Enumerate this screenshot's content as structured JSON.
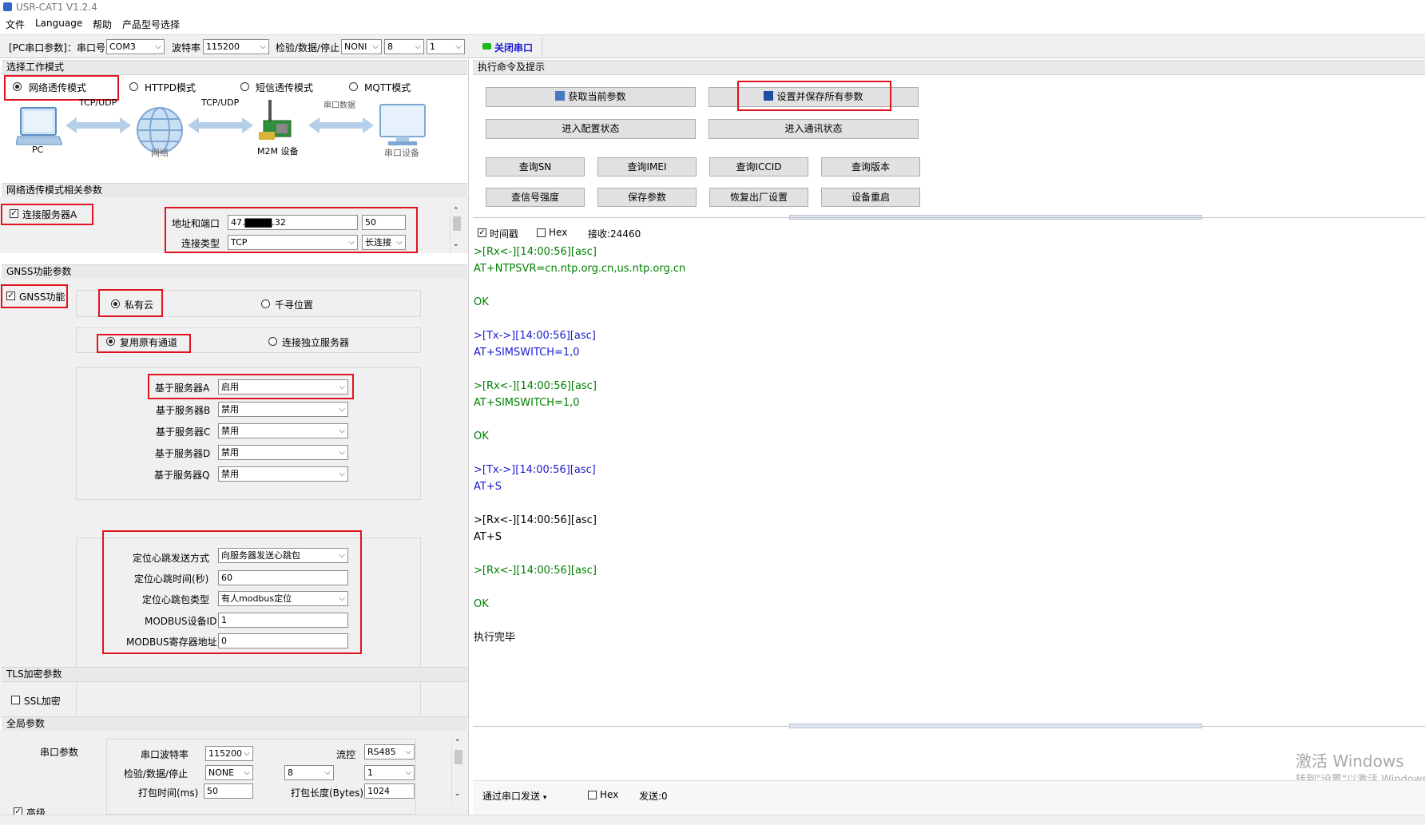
{
  "window": {
    "title": "USR-CAT1 V1.2.4"
  },
  "menu": [
    "文件",
    "Language",
    "帮助",
    "产品型号选择"
  ],
  "serial_bar": {
    "prefix": "[PC串口参数]：串口号",
    "port": "COM3",
    "baud_label": "波特率",
    "baud": "115200",
    "parity_label": "检验/数据/停止",
    "parity": "NONI",
    "data_bits": "8",
    "stop_bits": "1",
    "close_label": "关闭串口",
    "status_color": "#19b919"
  },
  "left": {
    "mode_header": "选择工作模式",
    "modes": [
      {
        "label": "网络透传模式",
        "selected": true
      },
      {
        "label": "HTTPD模式",
        "selected": false
      },
      {
        "label": "短信透传模式",
        "selected": false
      },
      {
        "label": "MQTT模式",
        "selected": false
      }
    ],
    "diagram": {
      "pc": "PC",
      "link1": "TCP/UDP",
      "net": "网络",
      "link2": "TCP/UDP",
      "m2m": "M2M 设备",
      "link3": "串口数据",
      "serial_dev": "串口设备"
    },
    "net_header": "网络透传模式相关参数",
    "server_a_label": "连接服务器A",
    "addr_label": "地址和端口",
    "addr_value": "47.▇▇▇▇.32",
    "port_value": "50",
    "conn_type_label": "连接类型",
    "conn_type": "TCP",
    "conn_mode": "长连接",
    "gnss_header": "GNSS功能参数",
    "gnss_label": "GNSS功能",
    "private_cloud": "私有云",
    "qianxun": "千寻位置",
    "reuse_channel": "复用原有通道",
    "independent_server": "连接独立服务器",
    "servers": [
      {
        "label": "基于服务器A",
        "value": "启用"
      },
      {
        "label": "基于服务器B",
        "value": "禁用"
      },
      {
        "label": "基于服务器C",
        "value": "禁用"
      },
      {
        "label": "基于服务器D",
        "value": "禁用"
      },
      {
        "label": "基于服务器Q",
        "value": "禁用"
      }
    ],
    "heartbeat": {
      "mode_label": "定位心跳发送方式",
      "mode_value": "向服务器发送心跳包",
      "interval_label": "定位心跳时间(秒)",
      "interval_value": "60",
      "type_label": "定位心跳包类型",
      "type_value": "有人modbus定位",
      "modbus_id_label": "MODBUS设备ID",
      "modbus_id_value": "1",
      "modbus_reg_label": "MODBUS寄存器地址",
      "modbus_reg_value": "0"
    },
    "tls_header": "TLS加密参数",
    "ssl_label": "SSL加密",
    "global_header": "全局参数",
    "serial_params_label": "串口参数",
    "g_baud_label": "串口波特率",
    "g_baud": "115200",
    "flow_label": "流控",
    "flow_value": "RS485",
    "g_parity_label": "检验/数据/停止",
    "g_parity": "NONE",
    "g_data": "8",
    "g_stop": "1",
    "pack_time_label": "打包时间(ms)",
    "pack_time": "50",
    "pack_len_label": "打包长度(Bytes)",
    "pack_len": "1024",
    "advanced_label": "高级"
  },
  "right": {
    "header": "执行命令及提示",
    "btn_get_params": "获取当前参数",
    "btn_set_save": "设置并保存所有参数",
    "btn_enter_config": "进入配置状态",
    "btn_enter_comm": "进入通讯状态",
    "btn_sn": "查询SN",
    "btn_imei": "查询IMEI",
    "btn_iccid": "查询ICCID",
    "btn_version": "查询版本",
    "btn_signal": "查信号强度",
    "btn_save": "保存参数",
    "btn_factory": "恢复出厂设置",
    "btn_reboot": "设备重启",
    "timestamp_label": "时间戳",
    "hex_label": "Hex",
    "recv_label": "接收:24460",
    "log": [
      {
        "text": ">[Rx<-][14:00:56][asc]",
        "color": "g"
      },
      {
        "text": "AT+NTPSVR=cn.ntp.org.cn,us.ntp.org.cn",
        "color": "g"
      },
      {
        "text": "",
        "color": "k"
      },
      {
        "text": "OK",
        "color": "g"
      },
      {
        "text": "",
        "color": "k"
      },
      {
        "text": ">[Tx->][14:00:56][asc]",
        "color": "b"
      },
      {
        "text": "AT+SIMSWITCH=1,0",
        "color": "b"
      },
      {
        "text": "",
        "color": "k"
      },
      {
        "text": ">[Rx<-][14:00:56][asc]",
        "color": "g"
      },
      {
        "text": "AT+SIMSWITCH=1,0",
        "color": "g"
      },
      {
        "text": "",
        "color": "k"
      },
      {
        "text": "OK",
        "color": "g"
      },
      {
        "text": "",
        "color": "k"
      },
      {
        "text": ">[Tx->][14:00:56][asc]",
        "color": "b"
      },
      {
        "text": "AT+S",
        "color": "b"
      },
      {
        "text": "",
        "color": "k"
      },
      {
        "text": ">[Rx<-][14:00:56][asc]",
        "color": "k"
      },
      {
        "text": "AT+S",
        "color": "k"
      },
      {
        "text": "",
        "color": "k"
      },
      {
        "text": ">[Rx<-][14:00:56][asc]",
        "color": "g"
      },
      {
        "text": "",
        "color": "k"
      },
      {
        "text": "OK",
        "color": "g"
      },
      {
        "text": "",
        "color": "k"
      },
      {
        "text": "执行完毕",
        "color": "k"
      }
    ],
    "send_via_label": "通过串口发送",
    "send_hex_label": "Hex",
    "sent_label": "发送:0",
    "watermark_line1": "激活 Windows",
    "watermark_line2": "转到\"设置\"以激活 Windows。"
  }
}
